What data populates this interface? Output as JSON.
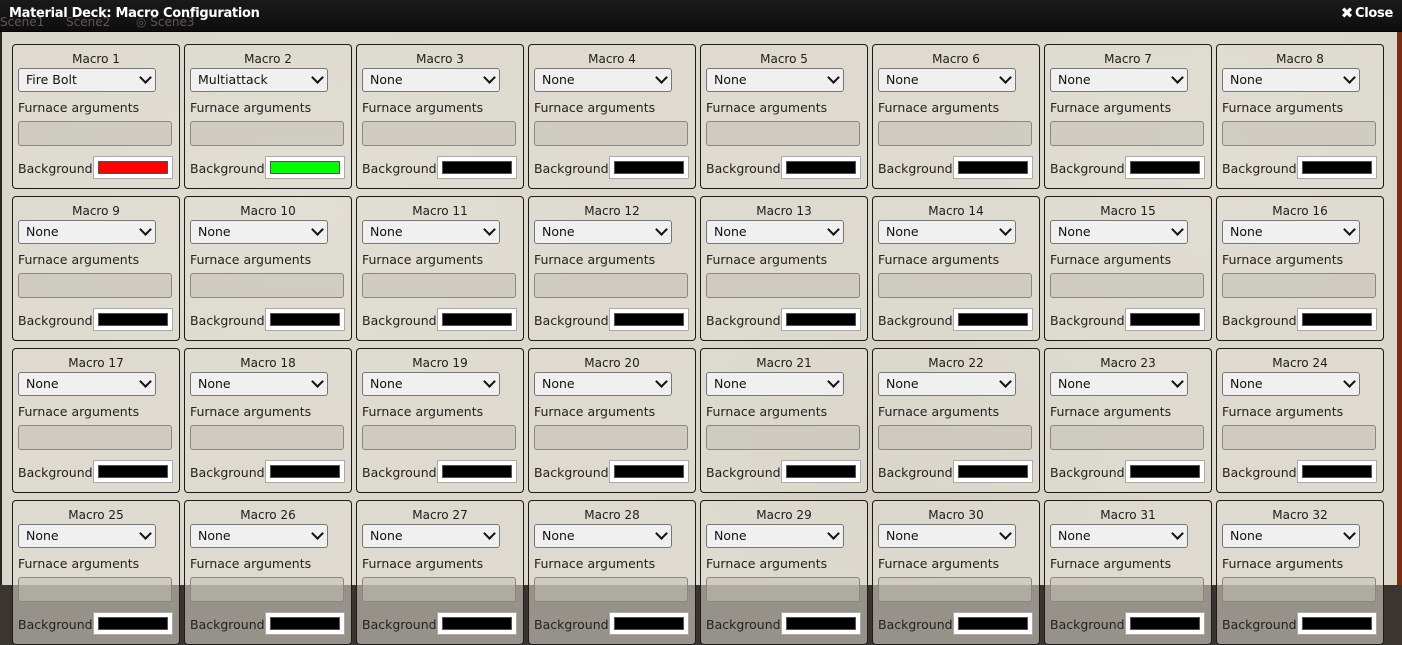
{
  "window": {
    "title": "Material Deck: Macro Configuration",
    "close_label": "Close",
    "background_tabs": [
      "Scene1",
      "Scene2",
      "Scene3"
    ]
  },
  "labels": {
    "furnace": "Furnace arguments",
    "background": "Background"
  },
  "macros": [
    {
      "title": "Macro 1",
      "selected": "Fire Bolt",
      "color": "#ff0000"
    },
    {
      "title": "Macro 2",
      "selected": "Multiattack",
      "color": "#00ff00"
    },
    {
      "title": "Macro 3",
      "selected": "None",
      "color": "#000000"
    },
    {
      "title": "Macro 4",
      "selected": "None",
      "color": "#000000"
    },
    {
      "title": "Macro 5",
      "selected": "None",
      "color": "#000000"
    },
    {
      "title": "Macro 6",
      "selected": "None",
      "color": "#000000"
    },
    {
      "title": "Macro 7",
      "selected": "None",
      "color": "#000000"
    },
    {
      "title": "Macro 8",
      "selected": "None",
      "color": "#000000"
    },
    {
      "title": "Macro 9",
      "selected": "None",
      "color": "#000000"
    },
    {
      "title": "Macro 10",
      "selected": "None",
      "color": "#000000"
    },
    {
      "title": "Macro 11",
      "selected": "None",
      "color": "#000000"
    },
    {
      "title": "Macro 12",
      "selected": "None",
      "color": "#000000"
    },
    {
      "title": "Macro 13",
      "selected": "None",
      "color": "#000000"
    },
    {
      "title": "Macro 14",
      "selected": "None",
      "color": "#000000"
    },
    {
      "title": "Macro 15",
      "selected": "None",
      "color": "#000000"
    },
    {
      "title": "Macro 16",
      "selected": "None",
      "color": "#000000"
    },
    {
      "title": "Macro 17",
      "selected": "None",
      "color": "#000000"
    },
    {
      "title": "Macro 18",
      "selected": "None",
      "color": "#000000"
    },
    {
      "title": "Macro 19",
      "selected": "None",
      "color": "#000000"
    },
    {
      "title": "Macro 20",
      "selected": "None",
      "color": "#000000"
    },
    {
      "title": "Macro 21",
      "selected": "None",
      "color": "#000000"
    },
    {
      "title": "Macro 22",
      "selected": "None",
      "color": "#000000"
    },
    {
      "title": "Macro 23",
      "selected": "None",
      "color": "#000000"
    },
    {
      "title": "Macro 24",
      "selected": "None",
      "color": "#000000"
    },
    {
      "title": "Macro 25",
      "selected": "None",
      "color": "#000000"
    },
    {
      "title": "Macro 26",
      "selected": "None",
      "color": "#000000"
    },
    {
      "title": "Macro 27",
      "selected": "None",
      "color": "#000000"
    },
    {
      "title": "Macro 28",
      "selected": "None",
      "color": "#000000"
    },
    {
      "title": "Macro 29",
      "selected": "None",
      "color": "#000000"
    },
    {
      "title": "Macro 30",
      "selected": "None",
      "color": "#000000"
    },
    {
      "title": "Macro 31",
      "selected": "None",
      "color": "#000000"
    },
    {
      "title": "Macro 32",
      "selected": "None",
      "color": "#000000"
    }
  ]
}
